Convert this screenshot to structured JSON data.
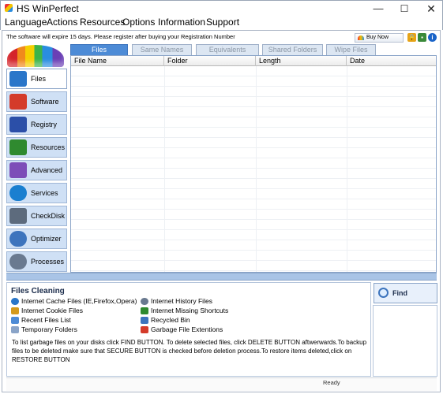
{
  "window": {
    "title": "HS WinPerfect",
    "minimize": "—",
    "maximize": "☐",
    "close": "✕"
  },
  "menu": [
    "Language",
    "Actions",
    "Resources",
    "Options",
    "Information",
    "Support"
  ],
  "notice": "The software will expire 15 days. Please register after buying your Registration Number",
  "buy_now": "Buy Now",
  "sidebar": [
    {
      "label": "Files",
      "icon": "folder-icon",
      "color": "#2a76c9"
    },
    {
      "label": "Software",
      "icon": "boxes-icon",
      "color": "#d43b2a"
    },
    {
      "label": "Registry",
      "icon": "registry-icon",
      "color": "#2b4fa8"
    },
    {
      "label": "Resources",
      "icon": "memory-icon",
      "color": "#2f8a2f"
    },
    {
      "label": "Advanced",
      "icon": "tools-icon",
      "color": "#7d4db8"
    },
    {
      "label": "Services",
      "icon": "gear-icon",
      "color": "#1a7fd0"
    },
    {
      "label": "CheckDisk",
      "icon": "disk-icon",
      "color": "#5d6b7d"
    },
    {
      "label": "Optimizer",
      "icon": "magnifier-icon",
      "color": "#3d74bd"
    },
    {
      "label": "Processes",
      "icon": "gears-icon",
      "color": "#6a7a90"
    }
  ],
  "tabs": [
    "Files",
    "Same Names",
    "Equivalents",
    "Shared Folders",
    "Wipe Files"
  ],
  "columns": [
    "File Name",
    "Folder",
    "Length",
    "Date"
  ],
  "section_title": "Files Cleaning",
  "clean_items_left": [
    {
      "label": "Internet Cache Files (IE,Firefox,Opera)",
      "color": "#2a76c9"
    },
    {
      "label": "Internet Cookie Files",
      "color": "#d49a1c"
    },
    {
      "label": "Recent Files List",
      "color": "#4d8bd6"
    },
    {
      "label": "Temporary Folders",
      "color": "#8aa4c8"
    }
  ],
  "clean_items_right": [
    {
      "label": "Internet History Files",
      "color": "#6a7a90"
    },
    {
      "label": "Internet Missing Shortcuts",
      "color": "#2f8a2f"
    },
    {
      "label": "Recycled Bin",
      "color": "#3d74bd"
    },
    {
      "label": "Garbage File Extentions",
      "color": "#d43b2a"
    }
  ],
  "instructions": "To list garbage files on your disks click FIND BUTTON. To delete selected files, click DELETE BUTTON aftwerwards.To backup files to be deleted make sure that SECURE BUTTON is checked before deletion process.To restore items deleted,click on RESTORE BUTTON",
  "find_button": "Find",
  "status": "Ready"
}
